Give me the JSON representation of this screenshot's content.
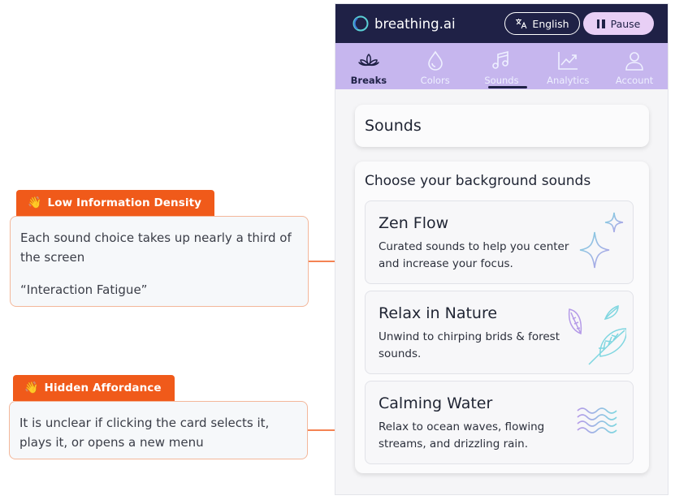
{
  "annotations": [
    {
      "tag_icon": "wave-hand-icon",
      "tag": "Low Information Density",
      "lines": [
        "Each sound choice takes up nearly a third of the screen",
        "“Interaction Fatigue”"
      ]
    },
    {
      "tag_icon": "wave-hand-icon",
      "tag": "Hidden Affordance",
      "lines": [
        "It is unclear if clicking the card selects it, plays it, or opens a new menu"
      ]
    }
  ],
  "app": {
    "brand": "breathing.ai",
    "language_label": "English",
    "pause_label": "Pause",
    "nav": [
      {
        "label": "Breaks",
        "icon": "lotus-icon",
        "active": true
      },
      {
        "label": "Colors",
        "icon": "droplet-icon",
        "active": false
      },
      {
        "label": "Sounds",
        "icon": "music-note-icon",
        "active": false
      },
      {
        "label": "Analytics",
        "icon": "trend-chart-icon",
        "active": false
      },
      {
        "label": "Account",
        "icon": "user-icon",
        "active": false
      }
    ],
    "section_title": "Sounds",
    "panel_title": "Choose your background sounds",
    "cards": [
      {
        "title": "Zen Flow",
        "description": "Curated sounds to help you center and increase your focus.",
        "art": "sparkles-icon"
      },
      {
        "title": "Relax in Nature",
        "description": "Unwind to chirping brids & forest sounds.",
        "art": "leaves-icon"
      },
      {
        "title": "Calming Water",
        "description": "Relax to ocean waves, flowing streams, and drizzling rain.",
        "art": "waves-icon"
      }
    ],
    "colors": {
      "topbar": "#1f2146",
      "navbar": "#c6b6ee",
      "pause_button": "#e8cff5",
      "annotation_accent": "#f05a1a"
    }
  }
}
